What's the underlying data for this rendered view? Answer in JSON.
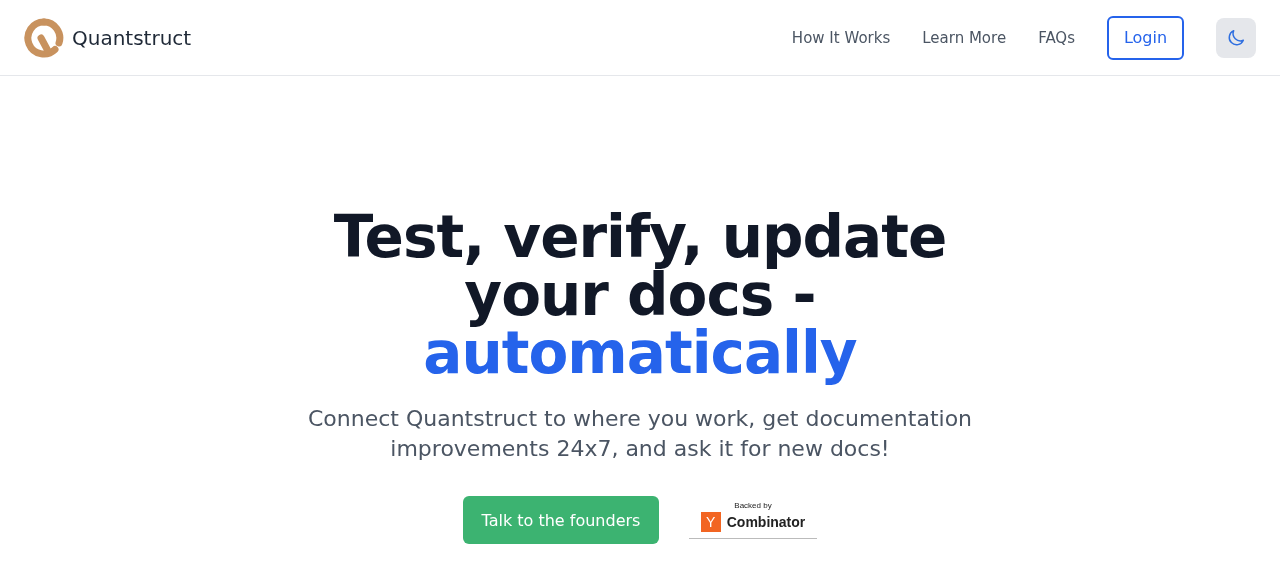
{
  "header": {
    "brand": "Quantstruct",
    "nav": [
      "How It Works",
      "Learn More",
      "FAQs"
    ],
    "login": "Login"
  },
  "hero": {
    "headline": "Test, verify, update your docs - ",
    "headline_highlight": "automatically",
    "subtitle": "Connect Quantstruct to where you work, get documentation improvements 24x7, and ask it for new docs!",
    "cta": "Talk to the founders",
    "badge": {
      "caption": "Backed by",
      "mark": "Y",
      "name": "Combinator"
    }
  }
}
